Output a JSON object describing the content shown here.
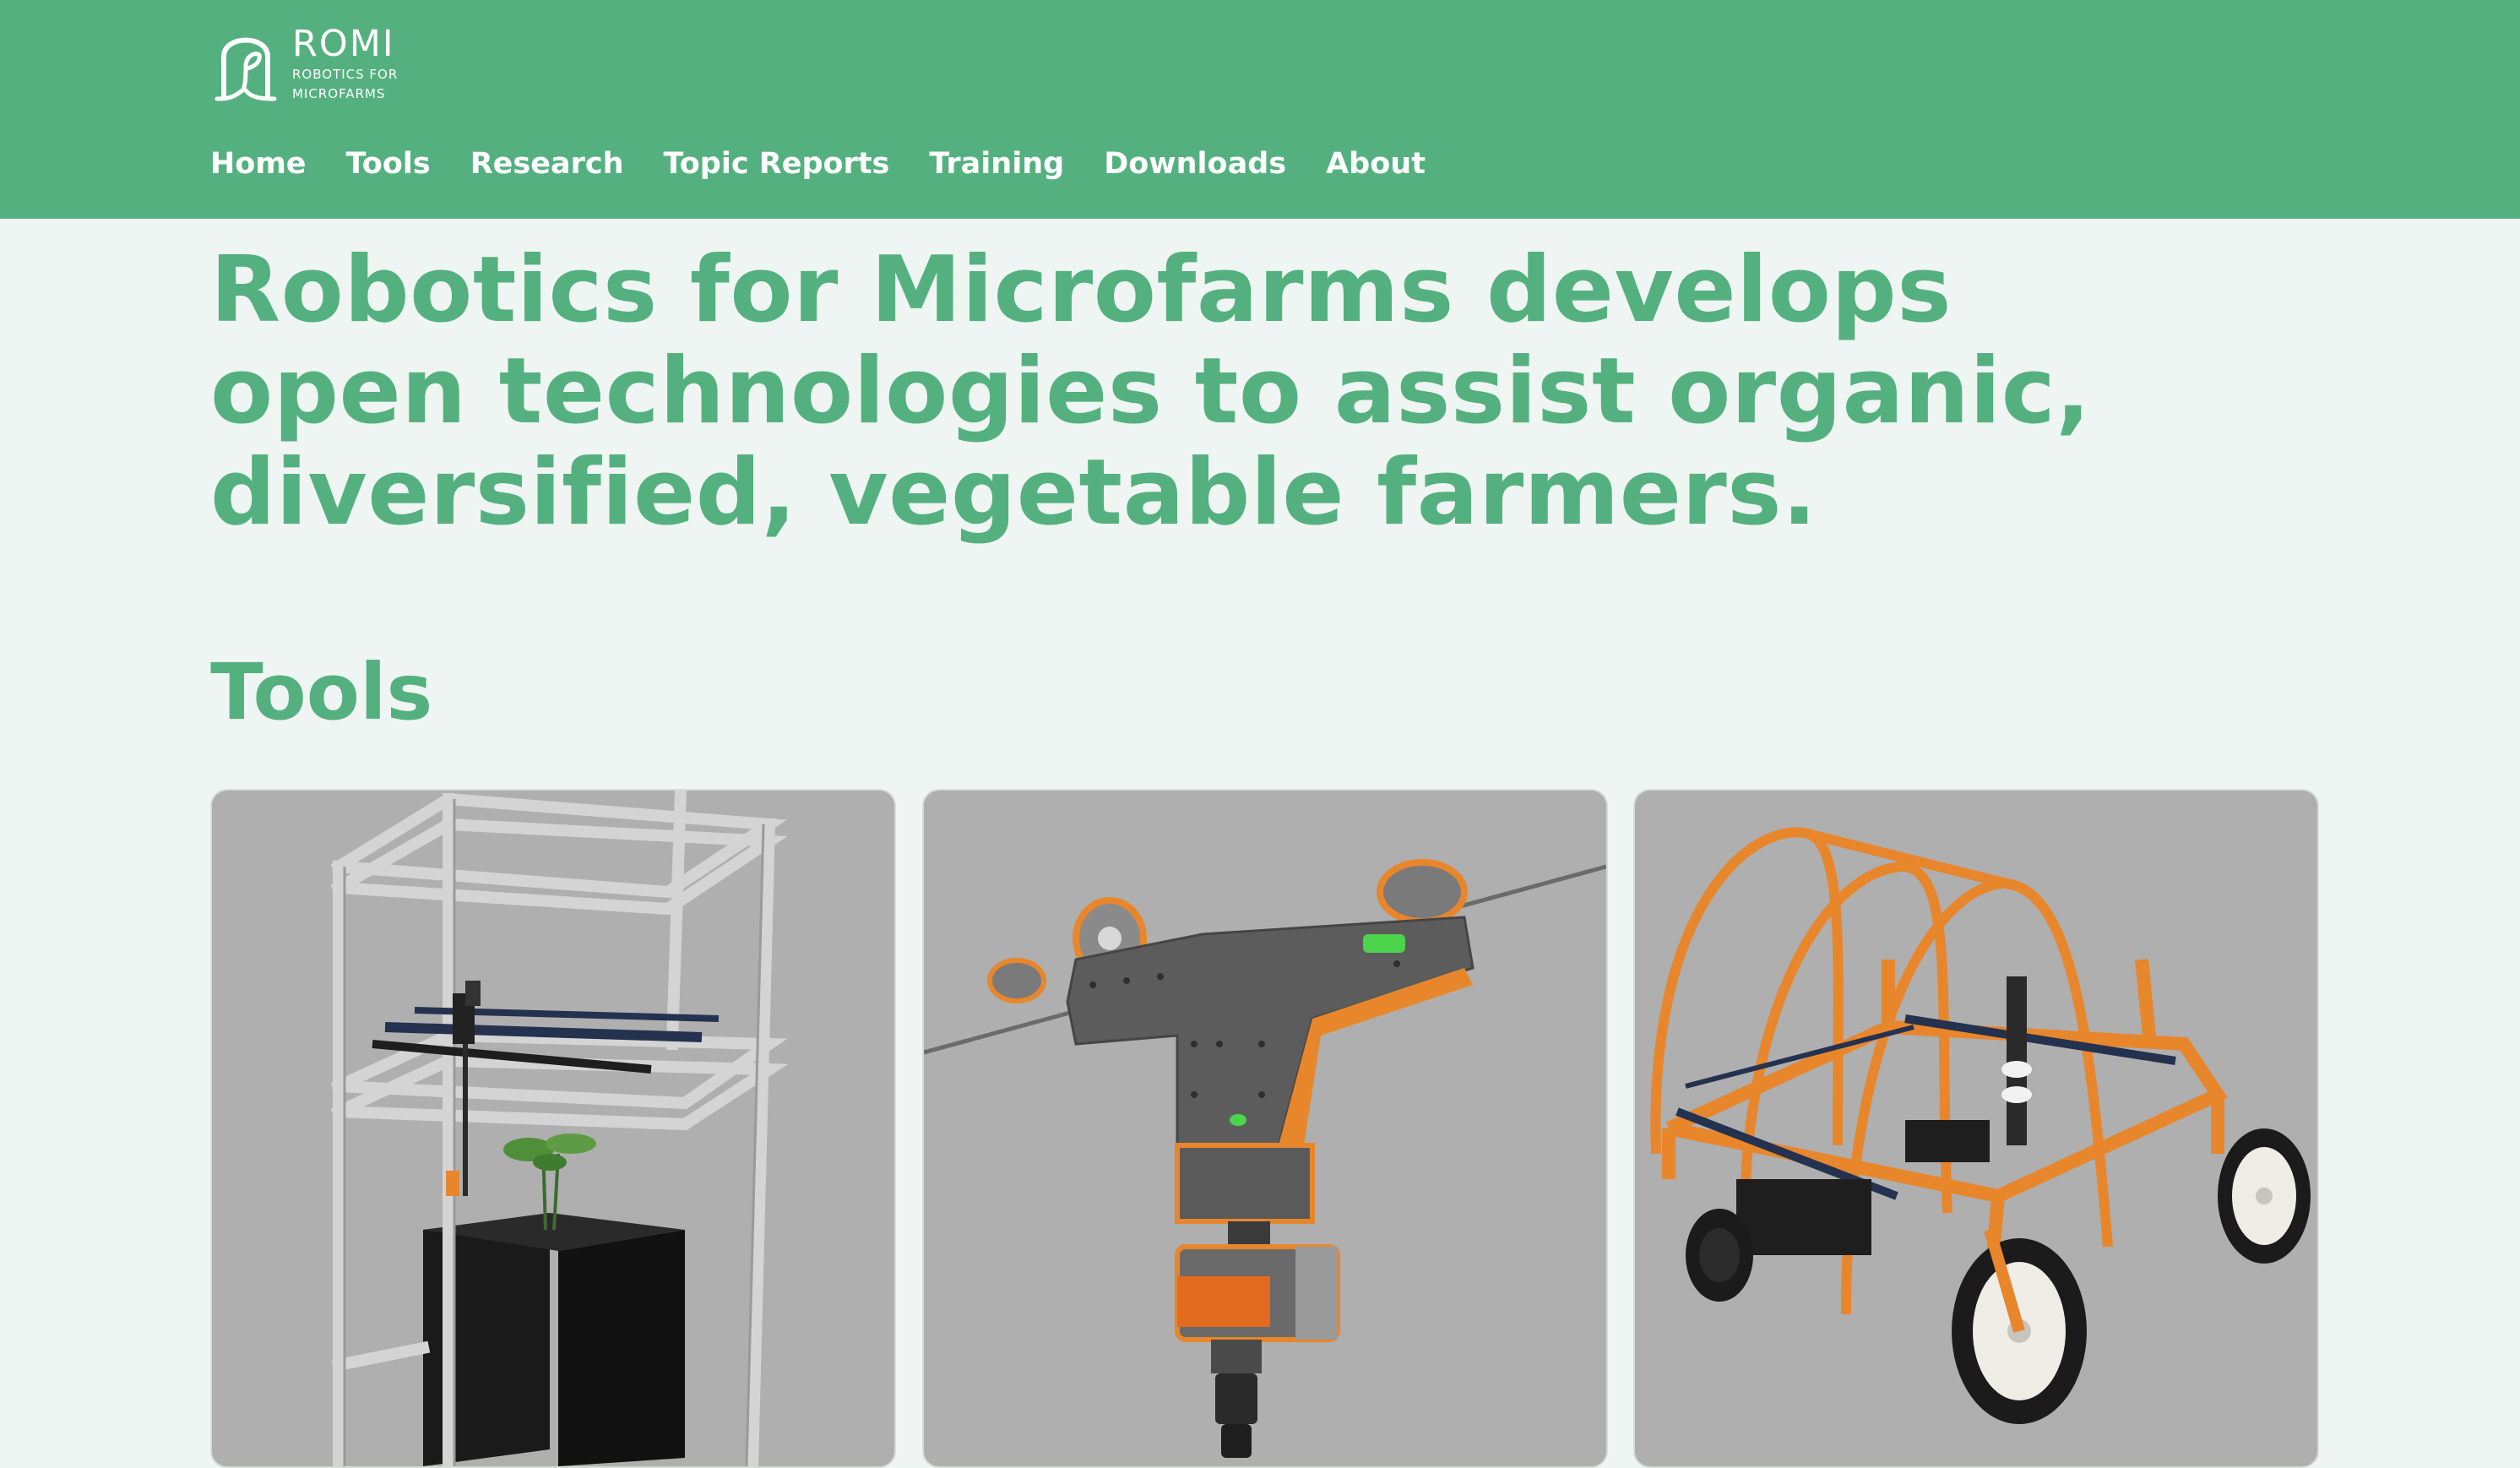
{
  "logo": {
    "name": "ROMI",
    "tagline_line1": "ROBOTICS FOR",
    "tagline_line2": "MICROFARMS"
  },
  "nav": {
    "items": [
      {
        "label": "Home"
      },
      {
        "label": "Tools"
      },
      {
        "label": "Research"
      },
      {
        "label": "Topic Reports"
      },
      {
        "label": "Training"
      },
      {
        "label": "Downloads"
      },
      {
        "label": "About"
      }
    ]
  },
  "hero": {
    "lines": [
      "Robotics for Microfarms develops",
      "open technologies to assist organic,",
      "diversified, vegetable farmers."
    ]
  },
  "tools": {
    "title": "Tools",
    "cards": [
      {
        "image": "plant-imager-render"
      },
      {
        "image": "cablebot-render"
      },
      {
        "image": "rover-render"
      }
    ]
  },
  "colors": {
    "brand_green": "#54b17f",
    "page_background": "#eff5f2",
    "card_background": "#b0b0b0",
    "accent_orange": "#e8862c"
  }
}
